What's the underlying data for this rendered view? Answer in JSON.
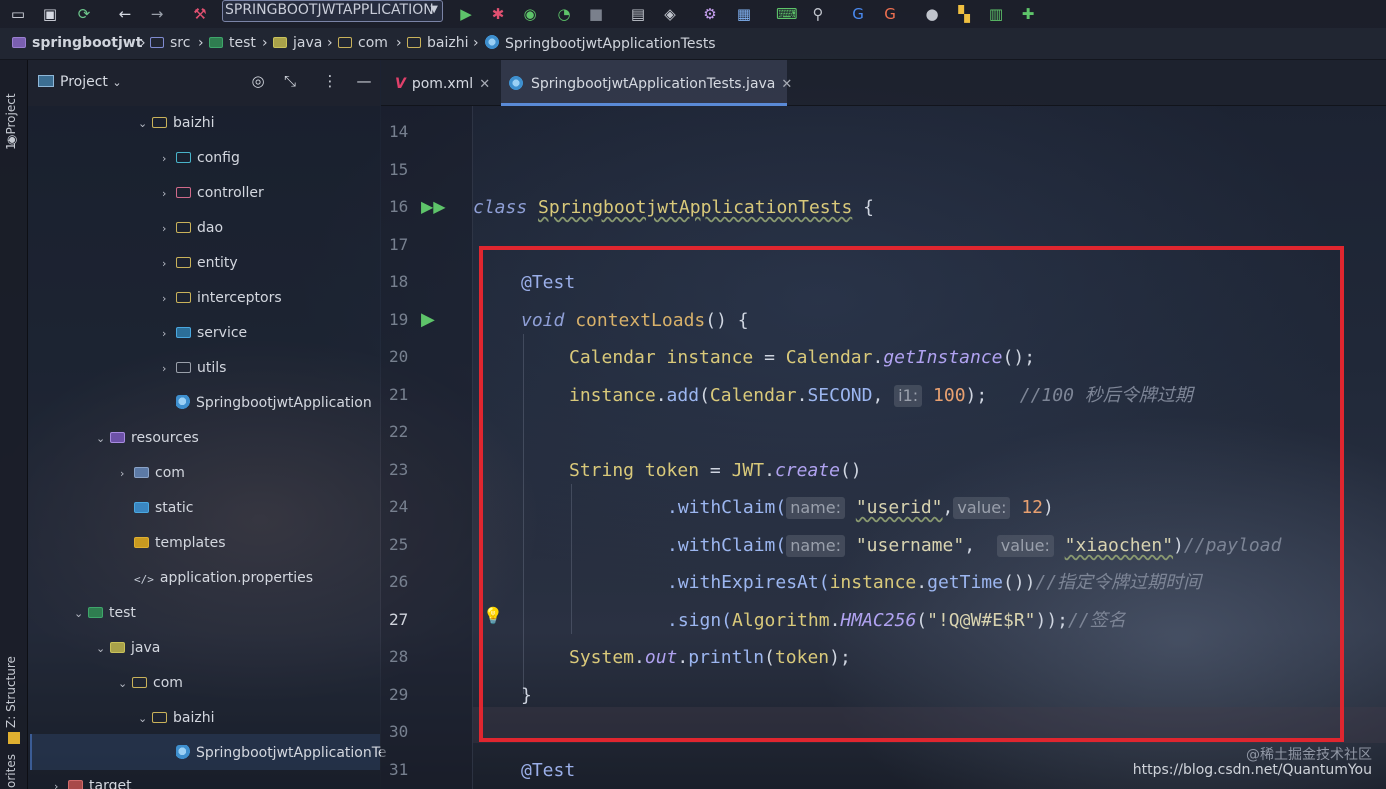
{
  "toolbar": {
    "run_config": "SPRINGBOOTJWTAPPLICATION",
    "icons": [
      "folder-icon",
      "save-icon",
      "sync-icon",
      "back-icon",
      "forward-icon",
      "build-hammer-icon",
      "run-icon",
      "debug-bug-icon",
      "coverage-icon",
      "profiler-icon",
      "stop-icon",
      "device-icon",
      "cube-icon",
      "settings-gear-icon",
      "grid-icon",
      "terminal-icon",
      "search-icon",
      "google-translate-icon",
      "translate-icon",
      "record-icon",
      "plugin-icon",
      "puzzle-icon"
    ]
  },
  "breadcrumb": [
    "springbootjwt",
    "src",
    "test",
    "java",
    "com",
    "baizhi",
    "SpringbootjwtApplicationTests"
  ],
  "side_strip": {
    "project": "1: Project",
    "structure": "Z: Structure",
    "favorites": "orites"
  },
  "project_panel": {
    "title": "Project",
    "tree": [
      {
        "label": "baizhi",
        "kind": "pkg",
        "expanded": true
      },
      {
        "label": "config",
        "kind": "cfg"
      },
      {
        "label": "controller",
        "kind": "ctl"
      },
      {
        "label": "dao",
        "kind": "pkg"
      },
      {
        "label": "entity",
        "kind": "pkg"
      },
      {
        "label": "interceptors",
        "kind": "pkg"
      },
      {
        "label": "service",
        "kind": "svc"
      },
      {
        "label": "utils",
        "kind": "utl"
      },
      {
        "label": "SpringbootjwtApplication",
        "kind": "cls"
      },
      {
        "label": "resources",
        "kind": "res",
        "expanded": true
      },
      {
        "label": "com",
        "kind": "gray"
      },
      {
        "label": "static",
        "kind": "web"
      },
      {
        "label": "templates",
        "kind": "tpl"
      },
      {
        "label": "application.properties",
        "kind": "prop"
      },
      {
        "label": "test",
        "kind": "tst",
        "expanded": true
      },
      {
        "label": "java",
        "kind": "jav",
        "expanded": true
      },
      {
        "label": "com",
        "kind": "pkg",
        "expanded": true
      },
      {
        "label": "baizhi",
        "kind": "pkg",
        "expanded": true
      },
      {
        "label": "SpringbootjwtApplicationTe",
        "kind": "cls"
      },
      {
        "label": "target",
        "kind": "tgt"
      }
    ]
  },
  "tabs": [
    {
      "label": "pom.xml",
      "active": false
    },
    {
      "label": "SpringbootjwtApplicationTests.java",
      "active": true
    }
  ],
  "editor": {
    "line_numbers": [
      "14",
      "15",
      "16",
      "17",
      "18",
      "19",
      "20",
      "21",
      "22",
      "23",
      "24",
      "25",
      "26",
      "27",
      "28",
      "29",
      "30",
      "31"
    ],
    "current_line": "27",
    "code": {
      "class_kw": "class",
      "class_name": "SpringbootjwtApplicationTests",
      "brace_open": " {",
      "test_annotation": "@Test",
      "void_kw": "void",
      "method_name": "contextLoads",
      "method_sig_rest": "() {",
      "l20_type": "Calendar",
      "l20_var": "instance",
      "l20_eq": " = ",
      "l20_cls": "Calendar",
      "l20_dot": ".",
      "l20_m": "getInstance",
      "l20_end": "();",
      "l21_a": "instance",
      "l21_b": ".",
      "l21_c": "add",
      "l21_d": "(",
      "l21_e": "Calendar",
      "l21_f": ".",
      "l21_g": "SECOND",
      "l21_h": ",",
      "l21_hint": "i1:",
      "l21_num": "100",
      "l21_end": ");",
      "l21_comment": "//100 秒后令牌过期",
      "l23_type": "String",
      "l23_var": "token",
      "l23_eq": " = ",
      "l23_cls": "JWT",
      "l23_dot": ".",
      "l23_m": "create",
      "l23_end": "()",
      "l24_a": ".withClaim(",
      "l24_hint1": "name:",
      "l24_str": "\"userid\"",
      "l24_comma": ",",
      "l24_hint2": "value:",
      "l24_num": "12",
      "l24_end": ")",
      "l25_a": ".withClaim(",
      "l25_hint1": "name:",
      "l25_str": "\"username\"",
      "l25_comma": ",",
      "l25_hint2": "value:",
      "l25_str2": "\"xiaochen\"",
      "l25_end": ")",
      "l25_comment": "//payload",
      "l26_a": ".withExpiresAt(",
      "l26_b": "instance",
      "l26_c": ".",
      "l26_d": "getTime",
      "l26_e": "())",
      "l26_comment": "//指定令牌过期时间",
      "l27_a": ".sign(",
      "l27_b": "Algorithm",
      "l27_c": ".",
      "l27_d": "HMAC256",
      "l27_e": "(",
      "l27_str": "\"!Q@W#E$R\"",
      "l27_end": "));",
      "l27_comment": "//签名",
      "l28_a": "System",
      "l28_b": ".",
      "l28_c": "out",
      "l28_d": ".",
      "l28_e": "println",
      "l28_f": "(",
      "l28_g": "token",
      "l28_h": ");",
      "l29": "}",
      "l31": "@Test"
    }
  },
  "watermark": {
    "line1": "@稀土掘金技术社区",
    "line2": "https://blog.csdn.net/QuantumYou"
  },
  "colors": {
    "highlight_box": "#e0262f",
    "active_tab_underline": "#5a8ad6"
  }
}
